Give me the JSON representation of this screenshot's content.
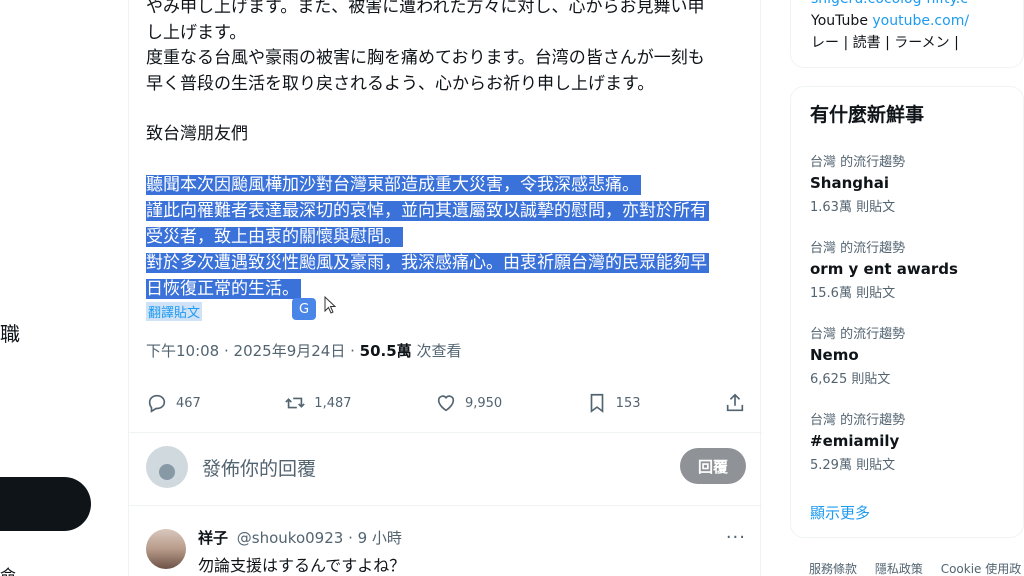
{
  "left_edge": {
    "cut_text": "職",
    "cut_text_bottom": "命"
  },
  "tweet": {
    "jp_line1": "やみ申し上げます。また、被害に遭われた方々に対し、心からお見舞い申",
    "jp_line2": "し上げます。",
    "jp_line3": "度重なる台風や豪雨の被害に胸を痛めております。台湾の皆さんが一刻も",
    "jp_line4": "早く普段の生活を取り戻されるよう、心からお祈り申し上げます。",
    "greeting": "致台灣朋友們",
    "zh_lines": [
      "聽聞本次因颱風樺加沙對台灣東部造成重大災害，令我深感悲痛。",
      "謹此向罹難者表達最深切的哀悼，並向其遺屬致以誠摯的慰問，亦對於所有",
      "受災者，致上由衷的關懷與慰問。",
      "對於多次遭遇致災性颱風及豪雨，我深感痛心。由衷祈願台灣的民眾能夠早",
      "日恢復正常的生活。"
    ],
    "translate_label": "翻譯貼文",
    "translate_badge": "G",
    "time": "下午10:08 · 2025年9月24日 · ",
    "views_count": "50.5萬",
    "views_label": " 次查看",
    "actions": {
      "replies": "467",
      "reposts": "1,487",
      "likes": "9,950",
      "bookmarks": "153"
    }
  },
  "reply_box": {
    "placeholder": "發佈你的回覆",
    "button": "回覆"
  },
  "comment": {
    "name": "祥子",
    "handle": "@shouko0923 · 9 小時",
    "more": "···",
    "text": "勿論支援はするんですよね？"
  },
  "sidebar": {
    "top_line1": "shigeru.cocolog-nifty.c",
    "top_yt_label": "YouTube ",
    "top_yt_link": "youtube.com/",
    "top_line3": "レー | 読書 | ラーメン |",
    "trends_title": "有什麼新鮮事",
    "trends": [
      {
        "context": "台灣 的流行趨勢",
        "name": "Shanghai",
        "count": "1.63萬 則貼文"
      },
      {
        "context": "台灣 的流行趨勢",
        "name": "orm y ent awards",
        "count": "15.6萬 則貼文"
      },
      {
        "context": "台灣 的流行趨勢",
        "name": "Nemo",
        "count": "6,625 則貼文"
      },
      {
        "context": "台灣 的流行趨勢",
        "name": "#emiamily",
        "count": "5.29萬 則貼文"
      }
    ],
    "show_more": "顯示更多",
    "footer": [
      "服務條款",
      "隱私政策",
      "Cookie 使用政"
    ]
  },
  "colors": {
    "highlight": "#3b72d9",
    "link": "#1d9bf0",
    "muted": "#536471",
    "reply_button": "#8f9397"
  }
}
